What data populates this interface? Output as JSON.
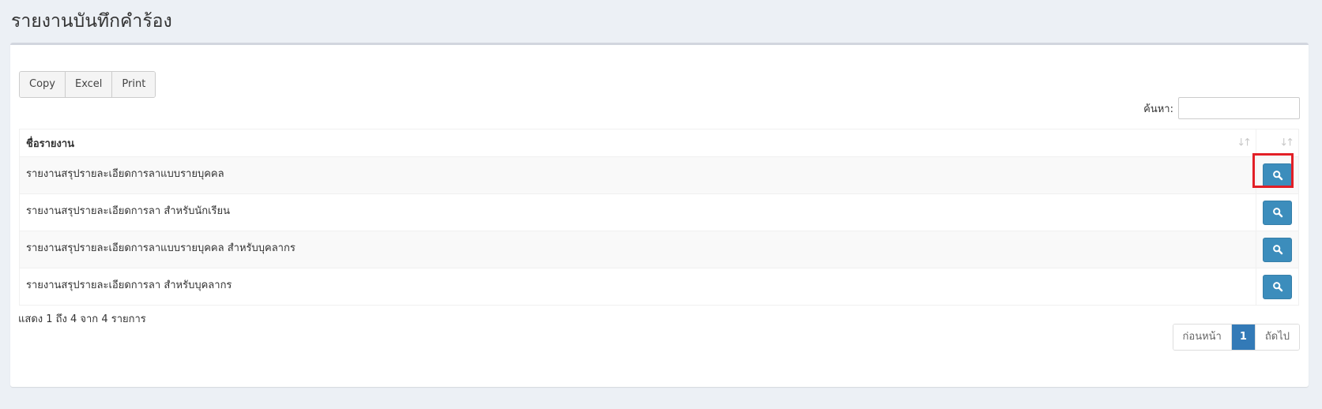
{
  "page": {
    "title": "รายงานบันทึกคำร้อง"
  },
  "toolbar": {
    "buttons": [
      "Copy",
      "Excel",
      "Print"
    ]
  },
  "search": {
    "label": "ค้นหา:",
    "value": ""
  },
  "table": {
    "columns": [
      "ชื่อรายงาน",
      ""
    ],
    "rows": [
      {
        "name": "รายงานสรุปรายละเอียดการลาแบบรายบุคคล"
      },
      {
        "name": "รายงานสรุปรายละเอียดการลา สำหรับนักเรียน"
      },
      {
        "name": "รายงานสรุปรายละเอียดการลาแบบรายบุคคล สำหรับบุคลากร"
      },
      {
        "name": "รายงานสรุปรายละเอียดการลา สำหรับบุคลากร"
      }
    ]
  },
  "info": "แสดง 1 ถึง 4 จาก 4 รายการ",
  "pagination": {
    "prev": "ก่อนหน้า",
    "current": "1",
    "next": "ถัดไป"
  },
  "icons": {
    "sort": "sort-icon",
    "view": "search-icon"
  },
  "colors": {
    "accent": "#3c8dbc",
    "active_page": "#337ab7",
    "highlight": "#e21f26"
  }
}
